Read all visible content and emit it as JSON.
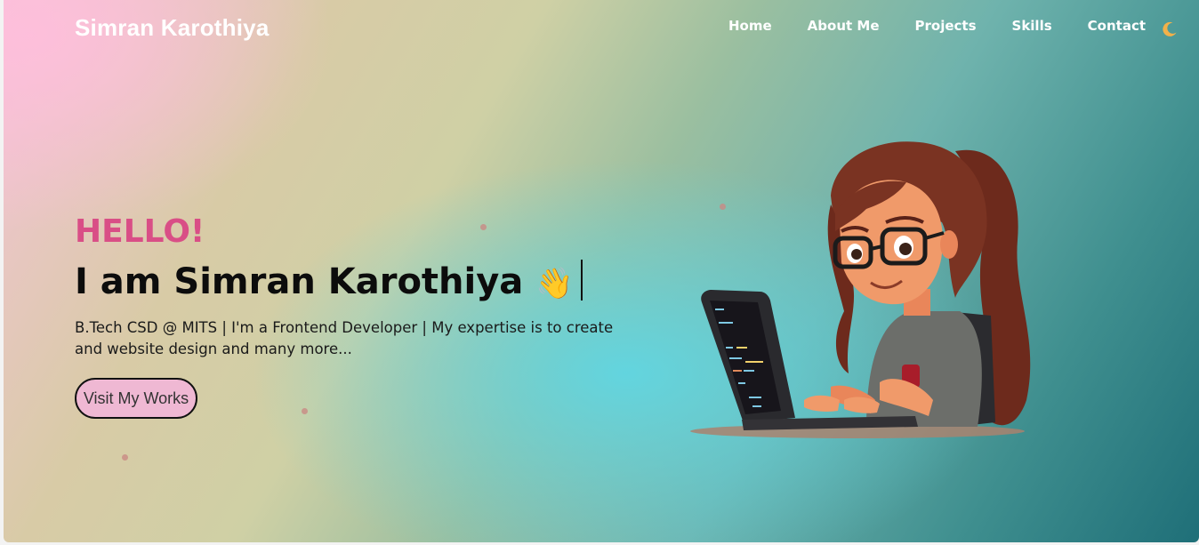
{
  "brand": {
    "name": "Simran Karothiya"
  },
  "nav": {
    "items": [
      {
        "label": "Home"
      },
      {
        "label": "About Me"
      },
      {
        "label": "Projects"
      },
      {
        "label": "Skills"
      },
      {
        "label": "Contact"
      }
    ],
    "theme_toggle_icon": "moon-icon"
  },
  "hero": {
    "greeting": "HELLO!",
    "headline": "I am Simran Karothiya",
    "wave_emoji": "👋",
    "description": "B.Tech CSD @ MITS | I'm a Frontend Developer | My expertise is to create and website design and many more...",
    "cta_label": "Visit My Works",
    "illustration_icon": "girl-coding-laptop-illustration"
  },
  "colors": {
    "accent_pink": "#d94e86",
    "button_bg": "#efb8d3",
    "text_dark": "#0c0c0c",
    "nav_text": "#ffffff"
  }
}
